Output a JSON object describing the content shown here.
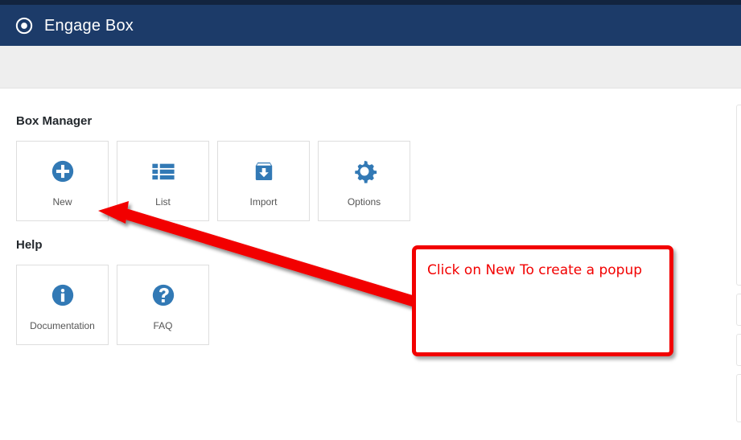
{
  "header": {
    "title": "Engage Box",
    "brand_icon": "target-dot-icon",
    "bar_color": "#1c3b69",
    "strip_color": "#12243f"
  },
  "theme": {
    "accent_blue": "#2a71b0",
    "icon_blue": "#3279b5",
    "annotation_red": "#f20000",
    "sub_band": "#eeeeee",
    "card_border": "#dedede",
    "label_color": "#555555"
  },
  "sections": [
    {
      "id": "box-manager",
      "title": "Box Manager",
      "cards": [
        {
          "label": "New",
          "icon": "plus-circle-icon"
        },
        {
          "label": "List",
          "icon": "list-grid-icon"
        },
        {
          "label": "Import",
          "icon": "inbox-download-icon"
        },
        {
          "label": "Options",
          "icon": "gear-icon"
        }
      ]
    },
    {
      "id": "help",
      "title": "Help",
      "cards": [
        {
          "label": "Documentation",
          "icon": "info-circle-icon"
        },
        {
          "label": "FAQ",
          "icon": "question-circle-icon"
        }
      ]
    }
  ],
  "annotation": {
    "callout_text": "Click on New To create a popup",
    "arrow": "red-arrow-pointing-to-new-card",
    "color": "#f20000"
  }
}
